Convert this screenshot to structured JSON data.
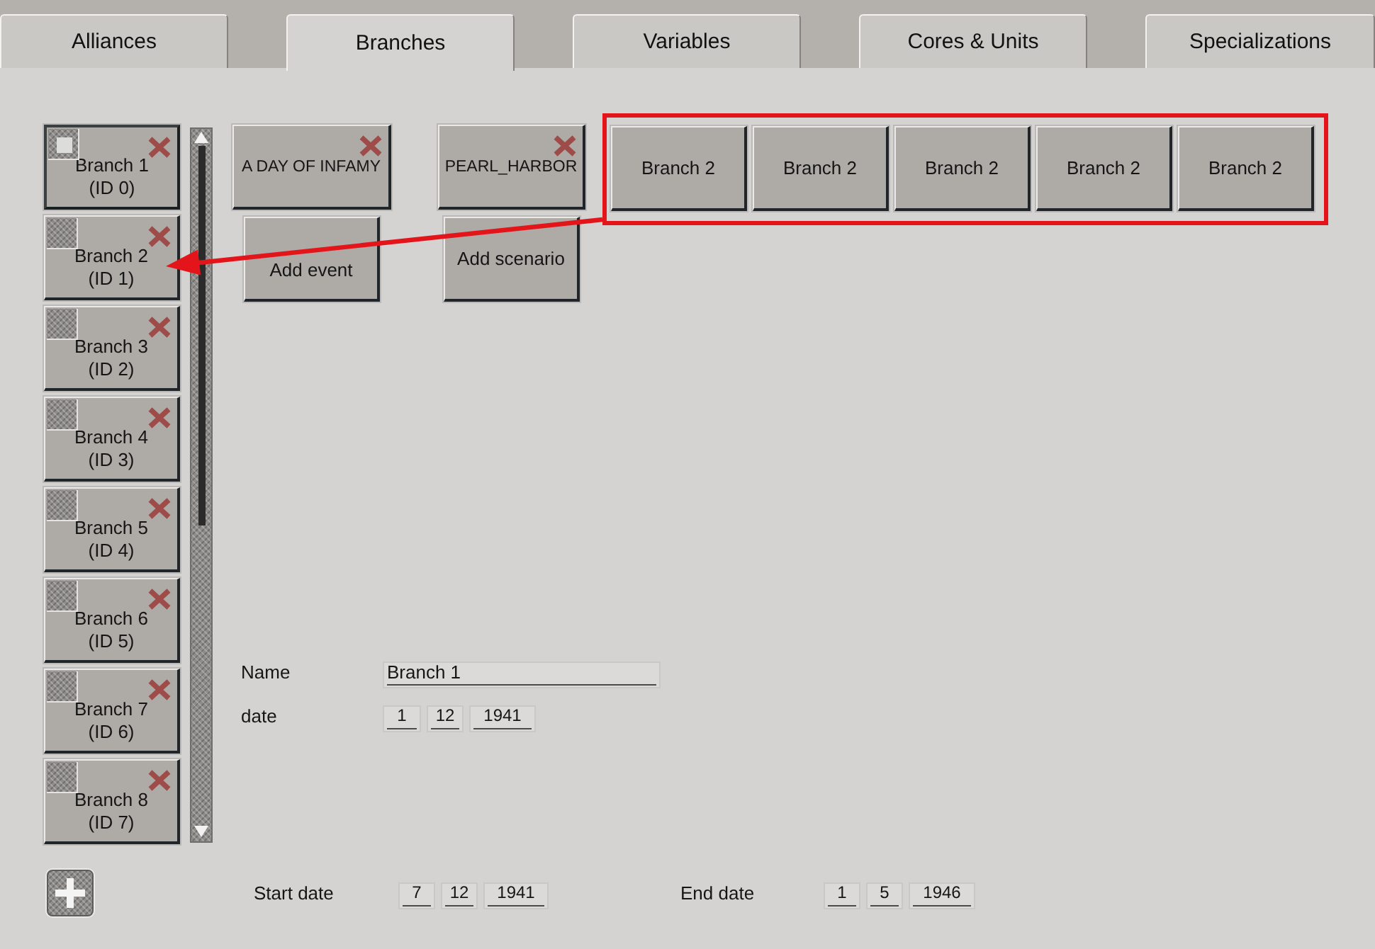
{
  "tabs": [
    {
      "label": "Alliances",
      "selected": false
    },
    {
      "label": "Branches",
      "selected": true
    },
    {
      "label": "Variables",
      "selected": false
    },
    {
      "label": "Cores & Units",
      "selected": false
    },
    {
      "label": "Specializations",
      "selected": false
    }
  ],
  "branches": [
    {
      "name": "Branch 1",
      "id": "(ID 0)",
      "selected": true
    },
    {
      "name": "Branch 2",
      "id": "(ID 1)",
      "selected": false
    },
    {
      "name": "Branch 3",
      "id": "(ID 2)",
      "selected": false
    },
    {
      "name": "Branch 4",
      "id": "(ID 3)",
      "selected": false
    },
    {
      "name": "Branch 5",
      "id": "(ID 4)",
      "selected": false
    },
    {
      "name": "Branch 6",
      "id": "(ID 5)",
      "selected": false
    },
    {
      "name": "Branch 7",
      "id": "(ID 6)",
      "selected": false
    },
    {
      "name": "Branch 8",
      "id": "(ID 7)",
      "selected": false
    }
  ],
  "events": {
    "items": [
      "A DAY OF INFAMY"
    ],
    "add_button": "Add event"
  },
  "scenarios": {
    "items": [
      "PEARL_HARBOR"
    ],
    "add_button": "Add scenario"
  },
  "linked_branches": [
    "Branch 2",
    "Branch 2",
    "Branch 2",
    "Branch 2",
    "Branch 2"
  ],
  "branch_details": {
    "name_label": "Name",
    "name": "Branch 1",
    "date_label": "date",
    "date": {
      "day": "1",
      "month": "12",
      "year": "1941"
    }
  },
  "scenario_dates": {
    "start_label": "Start date",
    "start": {
      "day": "7",
      "month": "12",
      "year": "1941"
    },
    "end_label": "End date",
    "end": {
      "day": "1",
      "month": "5",
      "year": "1946"
    }
  }
}
